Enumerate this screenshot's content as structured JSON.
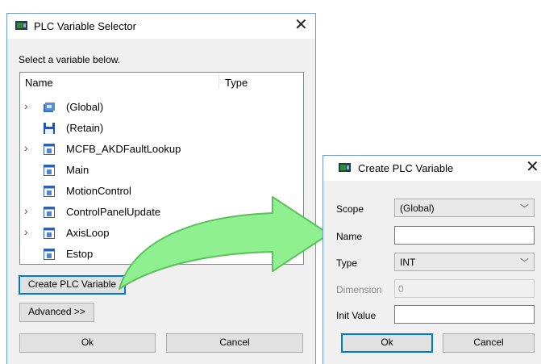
{
  "selector": {
    "title": "PLC Variable Selector",
    "instruction": "Select a variable below.",
    "columns": {
      "name": "Name",
      "type": "Type"
    },
    "rows": [
      {
        "label": "(Global)",
        "expandable": true,
        "icon": "global-icon"
      },
      {
        "label": "(Retain)",
        "expandable": false,
        "icon": "save-icon"
      },
      {
        "label": "MCFB_AKDFaultLookup",
        "expandable": true,
        "icon": "program-icon"
      },
      {
        "label": "Main",
        "expandable": false,
        "icon": "program-icon"
      },
      {
        "label": "MotionControl",
        "expandable": false,
        "icon": "program-icon"
      },
      {
        "label": "ControlPanelUpdate",
        "expandable": true,
        "icon": "program-icon"
      },
      {
        "label": "AxisLoop",
        "expandable": true,
        "icon": "program-icon"
      },
      {
        "label": "Estop",
        "expandable": false,
        "icon": "program-icon"
      }
    ],
    "create_button": "Create PLC Variable",
    "advanced_button": "Advanced >>",
    "ok_button": "Ok",
    "cancel_button": "Cancel"
  },
  "create": {
    "title": "Create PLC Variable",
    "scope_label": "Scope",
    "scope_value": "(Global)",
    "name_label": "Name",
    "name_value": "",
    "type_label": "Type",
    "type_value": "INT",
    "dimension_label": "Dimension",
    "dimension_value": "0",
    "init_label": "Init Value",
    "init_value": "",
    "ok_button": "Ok",
    "cancel_button": "Cancel"
  },
  "glyphs": {
    "close": "✕",
    "chevron": "›",
    "dropdown": "﹀"
  },
  "colors": {
    "accent": "#0078d7",
    "arrow_fill": "#8ff08f",
    "arrow_stroke": "#5cc05c"
  }
}
